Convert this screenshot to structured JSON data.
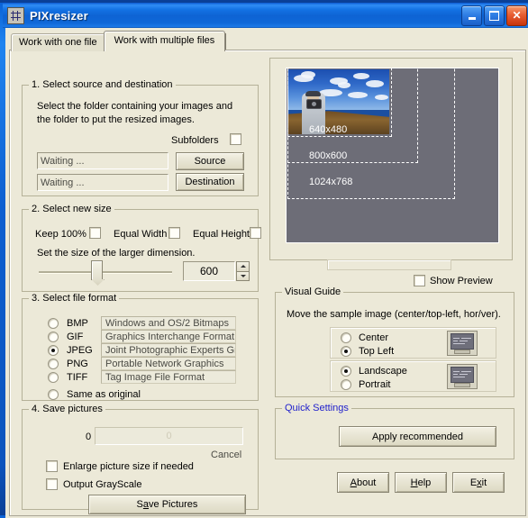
{
  "window": {
    "title": "PIXresizer",
    "icon": "app-grid-icon",
    "buttons": {
      "minimize": "minimize",
      "maximize": "maximize",
      "close": "close"
    }
  },
  "tabs": [
    {
      "label": "Work with one file",
      "active": false
    },
    {
      "label": "Work with multiple files",
      "active": true
    }
  ],
  "source_group": {
    "title": "1. Select source and destination",
    "description_line1": "Select the folder containing your images and",
    "description_line2": "the folder to put the resized images.",
    "subfolders_label": "Subfolders",
    "subfolders_checked": false,
    "source_value": "Waiting ...",
    "destination_value": "Waiting ...",
    "source_button": "Source",
    "destination_button": "Destination"
  },
  "size_group": {
    "title": "2. Select new size",
    "keep100_label": "Keep 100%",
    "keep100_checked": false,
    "equal_width_label": "Equal Width",
    "equal_width_checked": false,
    "equal_height_label": "Equal Height",
    "equal_height_checked": false,
    "instruction": "Set the size of the larger dimension.",
    "size_value": "600",
    "slider_percent": 36
  },
  "format_group": {
    "title": "3. Select file format",
    "options": [
      {
        "name": "BMP",
        "description": "Windows and OS/2 Bitmaps",
        "selected": false
      },
      {
        "name": "GIF",
        "description": "Graphics Interchange Format",
        "selected": false
      },
      {
        "name": "JPEG",
        "description": "Joint Photographic Experts Group",
        "selected": true
      },
      {
        "name": "PNG",
        "description": "Portable Network Graphics",
        "selected": false
      },
      {
        "name": "TIFF",
        "description": "Tag Image File Format",
        "selected": false
      }
    ],
    "same_as_original_label": "Same as original",
    "same_as_original_selected": false
  },
  "save_group": {
    "title": "4. Save pictures",
    "progress_left_label": "0",
    "progress_value_label": "0",
    "cancel_label": "Cancel",
    "enlarge_label": "Enlarge picture size if needed",
    "enlarge_checked": false,
    "grayscale_label": "Output GrayScale",
    "grayscale_checked": false,
    "save_button_pre": "S",
    "save_button_accel": "a",
    "save_button_post": "ve Pictures"
  },
  "preview": {
    "show_preview_label": "Show Preview",
    "show_preview_checked": false,
    "size_markers": [
      {
        "label": "640x480",
        "visible": false
      },
      {
        "label": "800x600",
        "visible": true
      },
      {
        "label": "1024x768",
        "visible": true
      }
    ]
  },
  "visual_guide": {
    "title": "Visual Guide",
    "instruction": "Move the sample image (center/top-left, hor/ver).",
    "position_options": [
      {
        "label": "Center",
        "selected": false
      },
      {
        "label": "Top Left",
        "selected": true
      }
    ],
    "orientation_options": [
      {
        "label": "Landscape",
        "selected": true
      },
      {
        "label": "Portrait",
        "selected": false
      }
    ],
    "monitor_icon": "monitor-icon"
  },
  "quick_settings": {
    "title": "Quick Settings",
    "apply_button": "Apply recommended"
  },
  "footer": {
    "about_pre": "",
    "about_accel": "A",
    "about_post": "bout",
    "help_pre": "",
    "help_accel": "H",
    "help_post": "elp",
    "exit_pre": "E",
    "exit_accel": "x",
    "exit_post": "it"
  },
  "colors": {
    "titlebar": "#1372e3",
    "face": "#ece9d8",
    "preview_bg": "#6d6d77",
    "quick_settings_title": "#2222cc"
  }
}
